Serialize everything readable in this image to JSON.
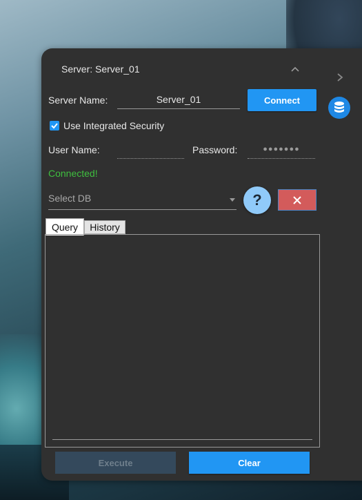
{
  "panel": {
    "title": "Server: Server_01"
  },
  "connection": {
    "server_name_label": "Server Name:",
    "server_name_value": "Server_01",
    "connect_label": "Connect",
    "integrated_security_label": "Use Integrated Security",
    "integrated_security_checked": true,
    "user_name_label": "User Name:",
    "user_name_value": "",
    "password_label": "Password:",
    "password_value": "●●●●●●●",
    "status": "Connected!",
    "status_color": "#3fbf3f"
  },
  "db": {
    "placeholder": "Select DB"
  },
  "actions": {
    "help_label": "?",
    "close_label": "✕"
  },
  "tabs": [
    {
      "label": "Query",
      "active": true
    },
    {
      "label": "History",
      "active": false
    }
  ],
  "footer": {
    "execute_label": "Execute",
    "clear_label": "Clear"
  },
  "colors": {
    "panel_bg": "#303030",
    "accent": "#2196f3",
    "danger": "#d35b5b"
  },
  "icons": [
    "chevron-up-icon",
    "chevron-right-icon",
    "database-icon",
    "checkbox-checked-icon",
    "dropdown-caret-icon",
    "close-icon"
  ]
}
